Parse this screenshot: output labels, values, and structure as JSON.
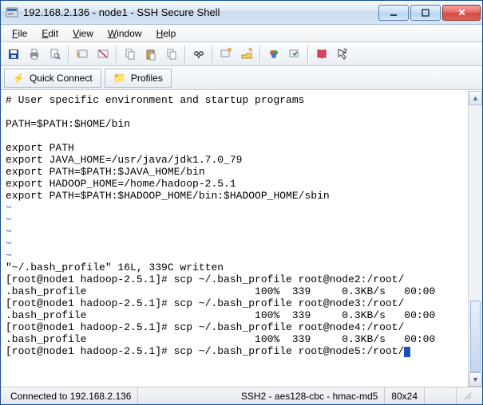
{
  "window": {
    "title": "192.168.2.136 - node1 - SSH Secure Shell"
  },
  "menu": {
    "file": "File",
    "edit": "Edit",
    "view": "View",
    "window": "Window",
    "help": "Help"
  },
  "toolbar2": {
    "quick_connect": "Quick Connect",
    "profiles": "Profiles"
  },
  "terminal": {
    "l1": "# User specific environment and startup programs",
    "l2": "",
    "l3": "PATH=$PATH:$HOME/bin",
    "l4": "",
    "l5": "export PATH",
    "l6": "export JAVA_HOME=/usr/java/jdk1.7.0_79",
    "l7": "export PATH=$PATH:$JAVA_HOME/bin",
    "l8": "export HADOOP_HOME=/home/hadoop-2.5.1",
    "l9": "export PATH=$PATH:$HADOOP_HOME/bin:$HADOOP_HOME/sbin",
    "tilde": "~",
    "l15": "\"~/.bash_profile\" 16L, 339C written",
    "l16": "[root@node1 hadoop-2.5.1]# scp ~/.bash_profile root@node2:/root/",
    "l17": ".bash_profile                           100%  339     0.3KB/s   00:00",
    "l18": "[root@node1 hadoop-2.5.1]# scp ~/.bash_profile root@node3:/root/",
    "l19": ".bash_profile                           100%  339     0.3KB/s   00:00",
    "l20": "[root@node1 hadoop-2.5.1]# scp ~/.bash_profile root@node4:/root/",
    "l21": ".bash_profile                           100%  339     0.3KB/s   00:00",
    "l22": "[root@node1 hadoop-2.5.1]# scp ~/.bash_profile root@node5:/root/"
  },
  "status": {
    "connected": "Connected to 192.168.2.136",
    "cipher": "SSH2 - aes128-cbc - hmac-md5",
    "size": "80x24"
  }
}
